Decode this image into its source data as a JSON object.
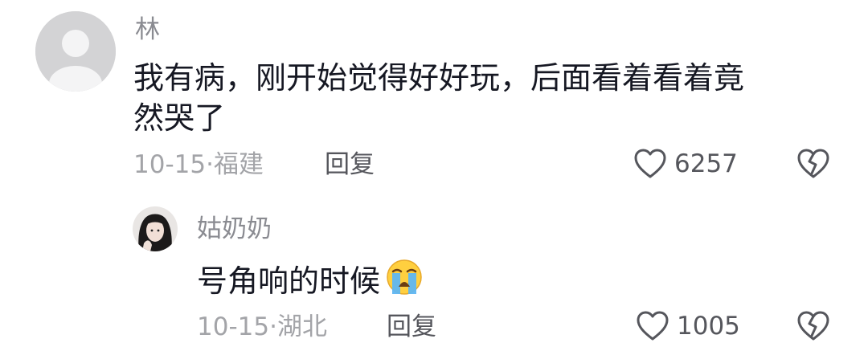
{
  "comments": [
    {
      "username": "林",
      "text_line1": "我有病，刚开始觉得好好玩，后面看着看着竟",
      "text_line2": "然哭了",
      "date": "10-15",
      "separator": "·",
      "location": "福建",
      "reply_label": "回复",
      "like_count": "6257",
      "avatar_icon": "default-user-avatar-icon"
    },
    {
      "username": "姑奶奶",
      "text": "号角响的时候",
      "emoji": "loudly-crying-face-emoji",
      "date": "10-15",
      "separator": "·",
      "location": "湖北",
      "reply_label": "回复",
      "like_count": "1005",
      "avatar_icon": "user-photo-avatar"
    }
  ],
  "icons": {
    "like": "heart-outline-icon",
    "dislike": "broken-heart-icon"
  },
  "colors": {
    "primary_text": "#161823",
    "secondary_text": "#8a8b91",
    "meta_text": "#a3a4a8",
    "action_text": "#55565c"
  }
}
